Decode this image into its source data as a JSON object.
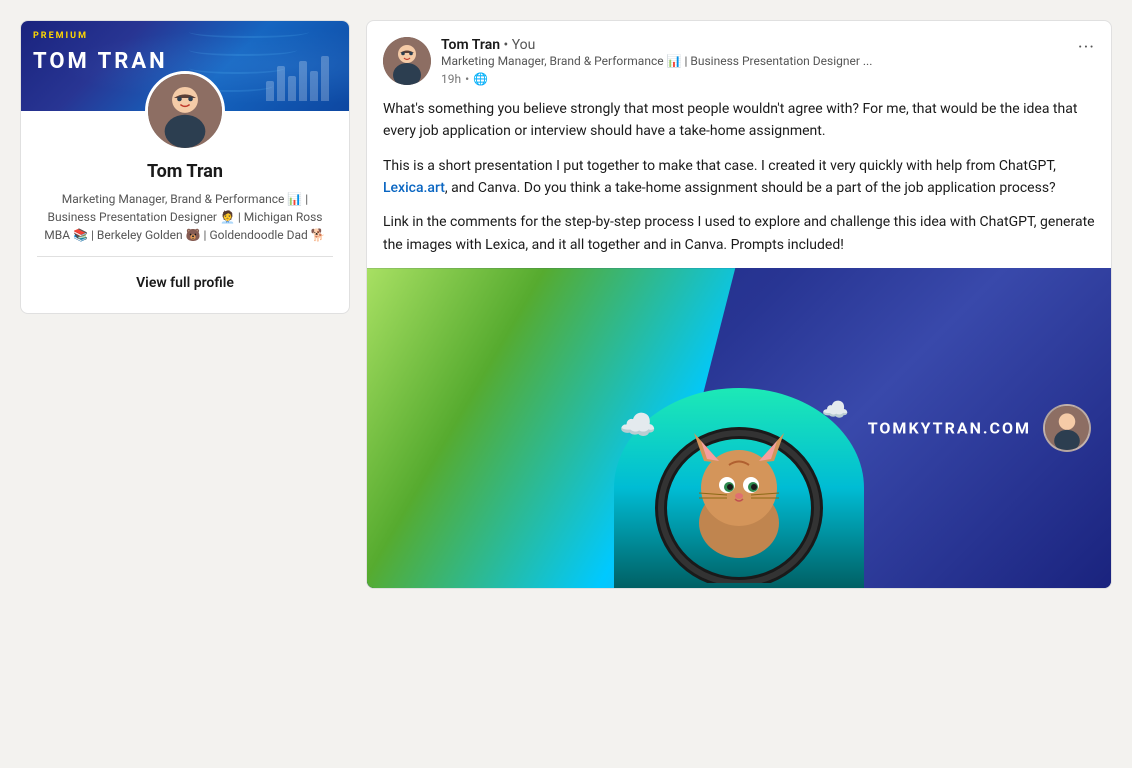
{
  "profile": {
    "banner_premium": "PREMIUM",
    "banner_name": "TOM TRAN",
    "name": "Tom Tran",
    "bio": "Marketing Manager, Brand & Performance 📊 | Business Presentation Designer 🧑‍💼 | Michigan Ross MBA 📚 | Berkeley Golden 🐻 | Goldendoodle Dad 🐕",
    "view_profile_label": "View full profile"
  },
  "post": {
    "author_name": "Tom Tran",
    "author_you": "• You",
    "author_title": "Marketing Manager, Brand & Performance 📊 | Business Presentation Designer ...",
    "time_ago": "19h",
    "visibility": "🌐",
    "more_icon": "···",
    "body_paragraph1": "What's something you believe strongly that most people wouldn't agree with? For me, that would be the idea that every job application or interview should have a take-home assignment.",
    "body_paragraph2_pre": "This is a short presentation I put together to make that case. I created it very quickly with help from ChatGPT, ",
    "body_paragraph2_link": "Lexica.art",
    "body_paragraph2_link_href": "#",
    "body_paragraph2_post": ", and Canva. Do you think a take-home assignment should be a part of the job application process?",
    "body_paragraph3": "Link in the comments for the step-by-step process I used to explore and challenge this idea with ChatGPT, generate the images with Lexica, and it all together and in Canva. Prompts included!",
    "image_website": "TOMKYTRAN.COM"
  }
}
